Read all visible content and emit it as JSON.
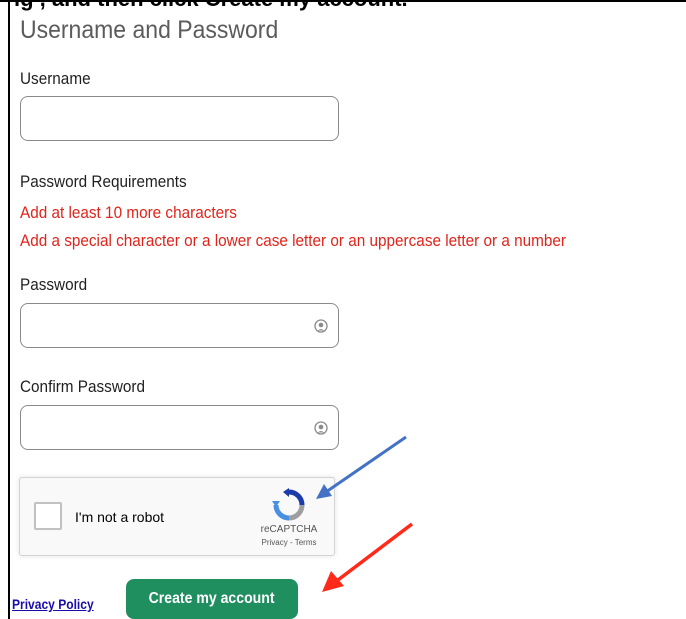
{
  "cropped_text": "ig          , and then click Create my account.",
  "form": {
    "title": "Username and Password",
    "username_label": "Username",
    "password_requirements_label": "Password Requirements",
    "requirements": [
      "Add at least 10 more characters",
      "Add a special character or a lower case letter or an uppercase letter or a number"
    ],
    "password_label": "Password",
    "confirm_password_label": "Confirm Password",
    "username_value": "",
    "password_value": "",
    "confirm_password_value": ""
  },
  "recaptcha": {
    "label": "I'm not a robot",
    "brand": "reCAPTCHA",
    "links": "Privacy - Terms",
    "checked": false
  },
  "footer": {
    "privacy_link": "Privacy Policy",
    "create_button": "Create my account"
  },
  "colors": {
    "requirement_text": "#e0241b",
    "button_bg": "#1f8f5f",
    "link": "#1a0dab",
    "arrow_blue": "#4472c4",
    "arrow_red": "#ff2a1a"
  },
  "icons": {
    "password_toggle": "eye-icon",
    "recaptcha_logo": "recaptcha-logo-icon"
  }
}
